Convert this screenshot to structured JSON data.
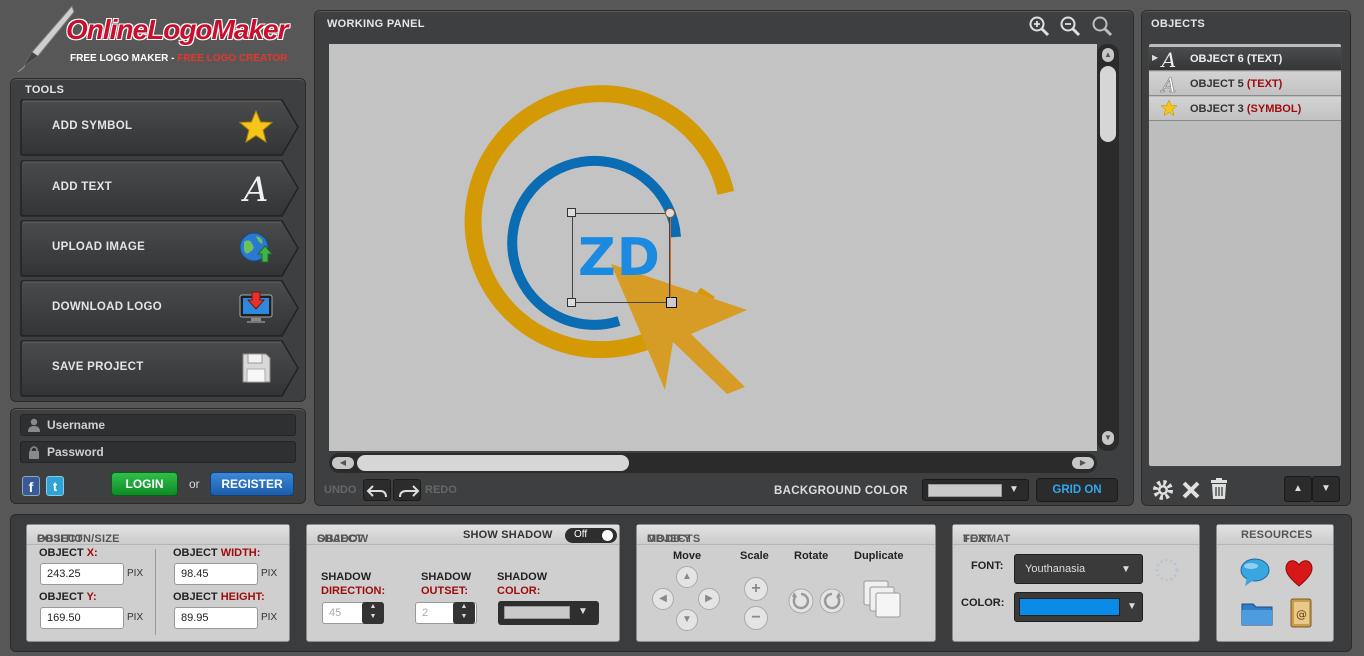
{
  "brand": {
    "name_part1": "Online",
    "name_part2": "Logo",
    "name_part3": "Maker",
    "tagline_white": "FREE LOGO MAKER - ",
    "tagline_red": "FREE LOGO CREATOR"
  },
  "tools": {
    "title": "TOOLS",
    "items": [
      {
        "label": "ADD SYMBOL",
        "icon": "star-icon"
      },
      {
        "label": "ADD TEXT",
        "icon": "text-a-icon"
      },
      {
        "label": "UPLOAD IMAGE",
        "icon": "globe-upload-icon"
      },
      {
        "label": "DOWNLOAD LOGO",
        "icon": "monitor-download-icon"
      },
      {
        "label": "SAVE PROJECT",
        "icon": "floppy-disk-icon"
      }
    ]
  },
  "login": {
    "username_placeholder": "Username",
    "password_placeholder": "Password",
    "login_label": "LOGIN",
    "or_label": "or",
    "register_label": "REGISTER"
  },
  "working_panel": {
    "title": "WORKING PANEL",
    "logo_text": "ZD",
    "undo_label": "UNDO",
    "redo_label": "REDO",
    "background_color_label": "BACKGROUND COLOR",
    "grid_label": "GRID ON",
    "colors": {
      "ring_outer": "#d49a06",
      "ring_inner": "#0a6db3",
      "text": "#1a8be0",
      "cursor": "#d79c26"
    }
  },
  "objects": {
    "title": "OBJECTS",
    "items": [
      {
        "prefix": "OBJECT 6 ",
        "type": "(TEXT)",
        "icon": "text-a-icon",
        "selected": true
      },
      {
        "prefix": "OBJECT 5 ",
        "type": "(TEXT)",
        "icon": "text-a-icon",
        "selected": false
      },
      {
        "prefix": "OBJECT 3 ",
        "type": "(SYMBOL)",
        "icon": "star-icon",
        "selected": false
      }
    ]
  },
  "position_size": {
    "title_a": "OBJECT ",
    "title_b": "POSITION/SIZE",
    "x_label_a": "OBJECT ",
    "x_label_b": "X:",
    "x_value": "243.25",
    "y_label_a": "OBJECT ",
    "y_label_b": "Y:",
    "y_value": "169.50",
    "w_label_a": "OBJECT ",
    "w_label_b": "WIDTH:",
    "w_value": "98.45",
    "h_label_a": "OBJECT ",
    "h_label_b": "HEIGHT:",
    "h_value": "89.95",
    "unit": "PIX"
  },
  "shadow": {
    "title_a": "OBJECT ",
    "title_b": "SHADOW",
    "show_label": "SHOW SHADOW",
    "toggle_value": "Off",
    "dir_label_a": "SHADOW",
    "dir_label_b": "DIRECTION:",
    "dir_value": "45",
    "outset_label_a": "SHADOW",
    "outset_label_b": "OUTSET:",
    "outset_value": "2",
    "color_label_a": "SHADOW",
    "color_label_b": "COLOR:"
  },
  "modify": {
    "title_a": "MODIFY ",
    "title_b": "OBJECTS",
    "move": "Move",
    "scale": "Scale",
    "rotate": "Rotate",
    "duplicate": "Duplicate"
  },
  "text_format": {
    "title_a": "TEXT ",
    "title_b": "FORMAT",
    "font_label": "FONT:",
    "font_value": "Youthanasia",
    "color_label": "COLOR:",
    "color_value": "#0b8be8"
  },
  "resources": {
    "title": "RESOURCES"
  }
}
